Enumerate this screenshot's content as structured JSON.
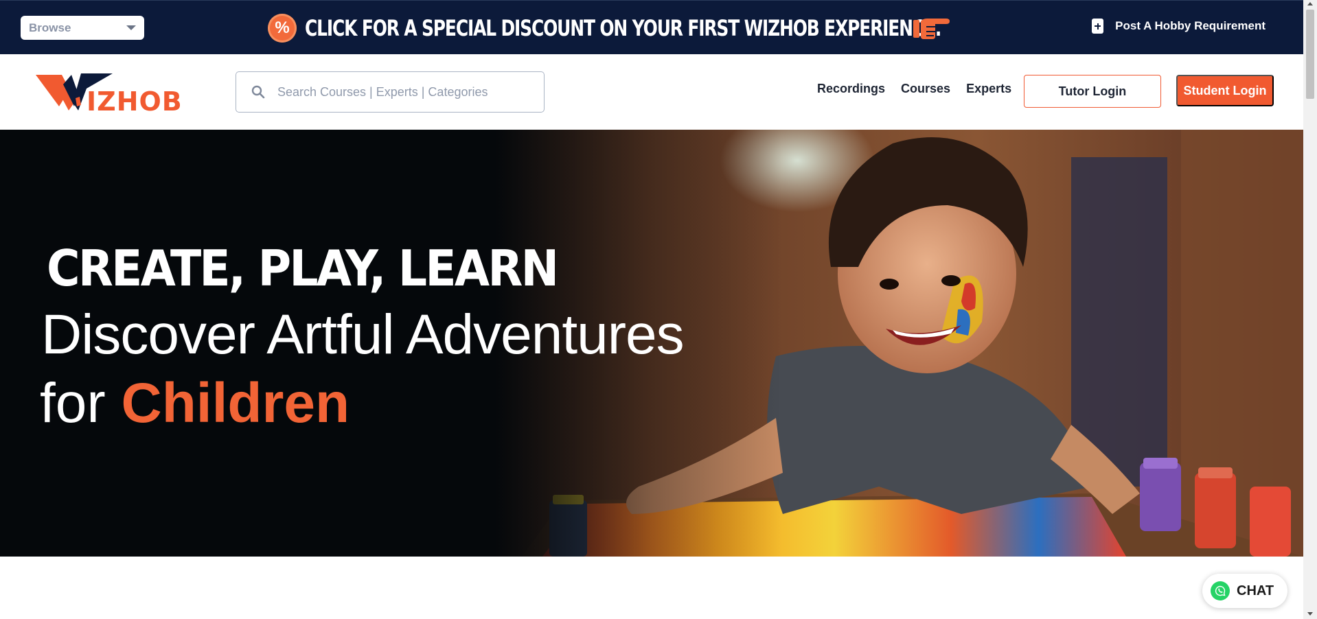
{
  "topbar": {
    "browse_label": "Browse",
    "promo_text": "CLICK FOR A SPECIAL DISCOUNT ON YOUR FIRST WIZHOB EXPERIENCE.",
    "promo_badge": "%",
    "post_requirement_label": "Post A Hobby Requirement",
    "background_color": "#0c1a3a",
    "accent_color": "#f26a3a"
  },
  "navbar": {
    "logo_text": "IZHOB",
    "search_placeholder": "Search Courses | Experts | Categories",
    "links": [
      "Recordings",
      "Courses",
      "Experts"
    ],
    "tutor_login_label": "Tutor Login",
    "student_login_label": "Student Login",
    "brand_color": "#f15a30"
  },
  "hero": {
    "line1": "CREATE, PLAY, LEARN",
    "line2": "Discover Artful Adventures",
    "line3_prefix": "for ",
    "line3_accent": "Children"
  },
  "chat": {
    "label": "CHAT"
  }
}
